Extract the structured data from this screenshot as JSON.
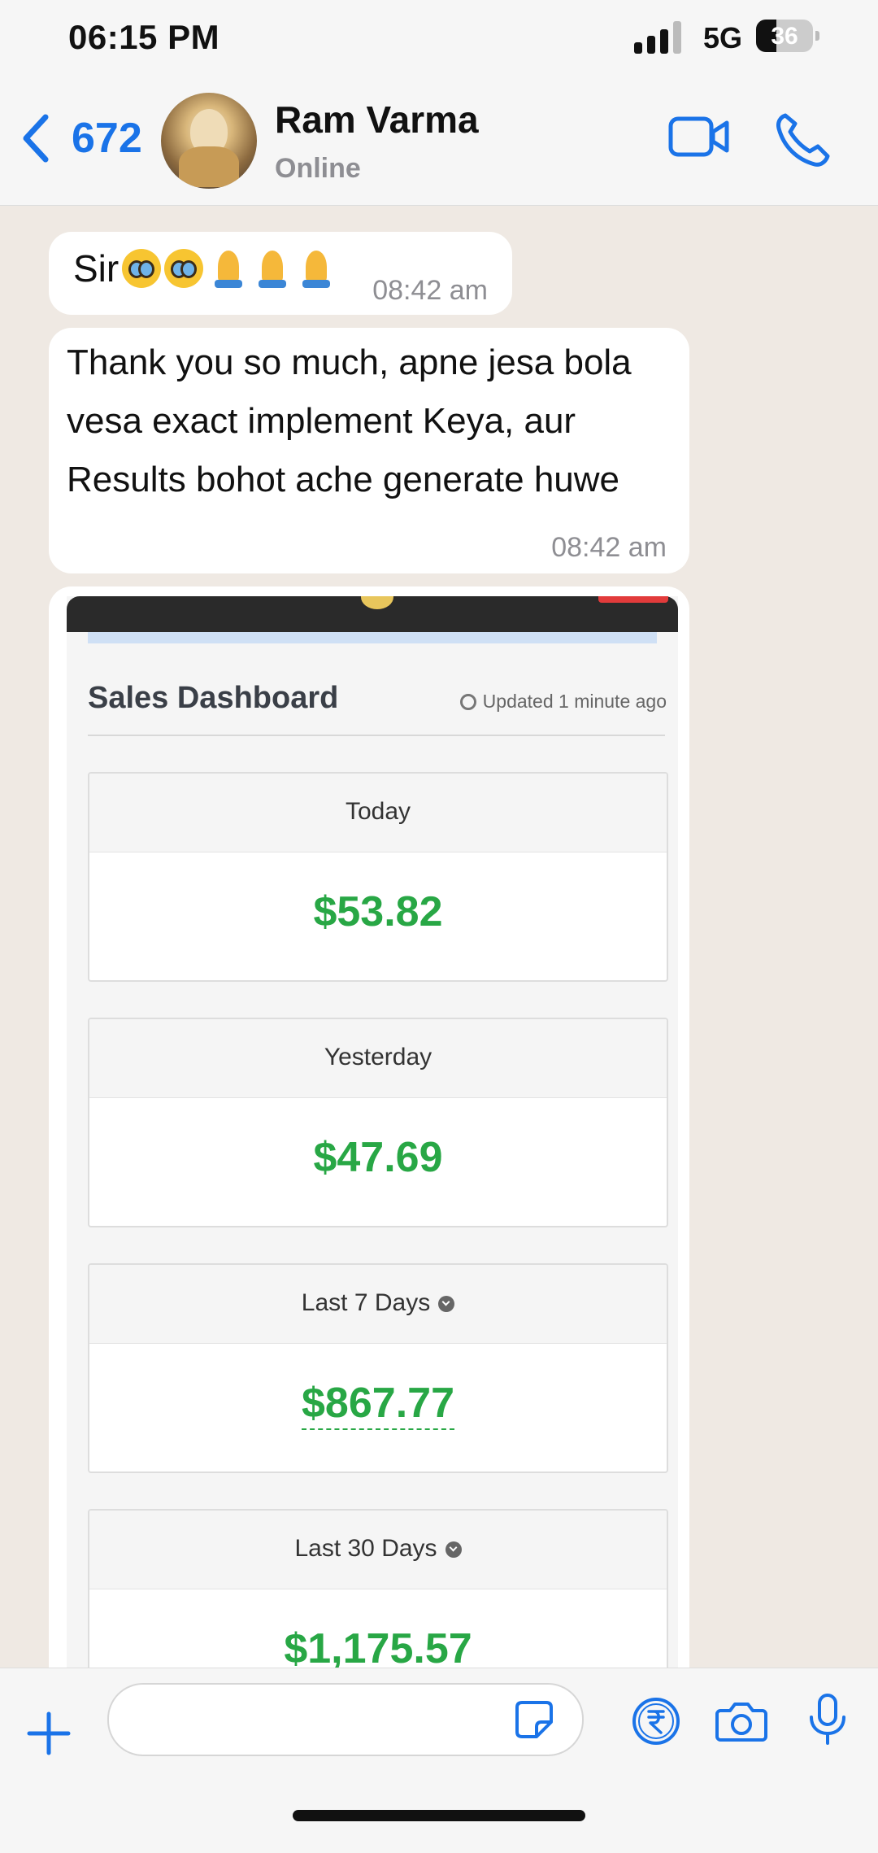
{
  "status_bar": {
    "time": "06:15 PM",
    "network": "5G",
    "battery": "36",
    "battery_fraction": 0.36
  },
  "header": {
    "back_count": "672",
    "contact_name": "Ram Varma",
    "contact_status": "Online"
  },
  "messages": [
    {
      "text": "Sir",
      "emoji": [
        "pleading-face",
        "pleading-face",
        "folded-hands",
        "folded-hands",
        "folded-hands"
      ],
      "time": "08:42 am"
    },
    {
      "lines": [
        " Thank you so much, apne jesa bola",
        "vesa exact implement Keya, aur",
        "Results bohot ache generate huwe"
      ],
      "time": "08:42 am"
    }
  ],
  "dashboard": {
    "title": "Sales Dashboard",
    "updated": "Updated 1 minute ago",
    "cards": [
      {
        "label": "Today",
        "value": "$53.82"
      },
      {
        "label": "Yesterday",
        "value": "$47.69"
      },
      {
        "label": "Last 7 Days",
        "value": "$867.77"
      },
      {
        "label": "Last 30 Days",
        "value": "$1,175.57"
      }
    ]
  },
  "colors": {
    "accent": "#1a73e8",
    "value_green": "#28a745",
    "chat_bg": "#efe9e3"
  },
  "icons": [
    "back-chevron-icon",
    "video-call-icon",
    "phone-icon",
    "plus-icon",
    "sticker-icon",
    "rupee-icon",
    "camera-icon",
    "microphone-icon",
    "clock-icon"
  ]
}
